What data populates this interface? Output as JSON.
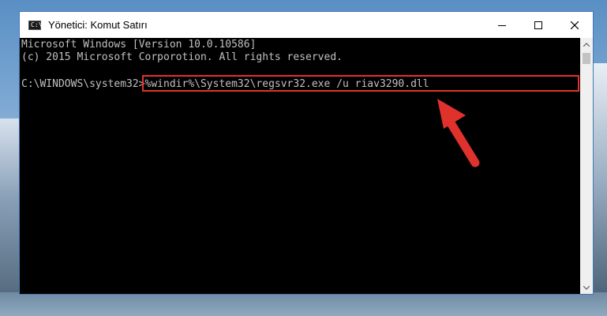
{
  "window": {
    "title": "Yönetici: Komut Satırı",
    "icon_label": "C:\\",
    "border_color": "#3f79b5"
  },
  "console": {
    "lines": [
      "Microsoft Windows [Version 10.0.10586]",
      "(c) 2015 Microsoft Corporotion. All rights reserved.",
      "",
      "C:\\WINDOWS\\system32>%windir%\\System32\\regsvr32.exe /u riav3290.dll"
    ],
    "text_color": "#c0c0c0"
  },
  "annotation": {
    "highlight_color": "#e0322c"
  },
  "icons": {
    "minimize": "minimize-icon",
    "maximize": "maximize-icon",
    "close": "close-icon",
    "arrow": "pointer-arrow-icon"
  }
}
